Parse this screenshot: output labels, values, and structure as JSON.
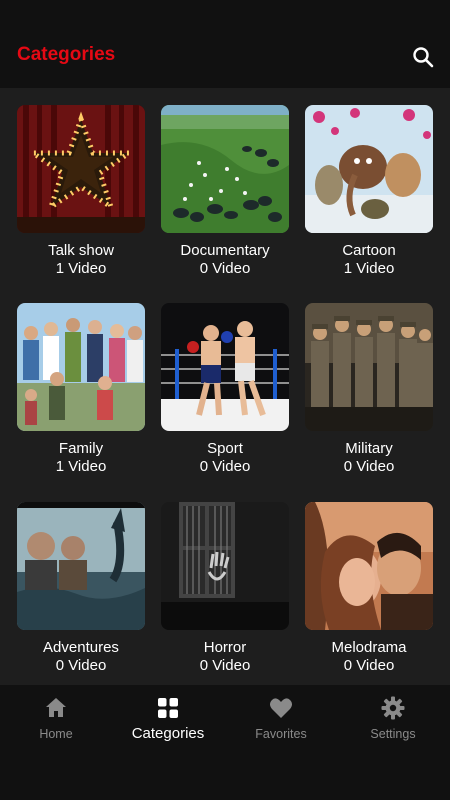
{
  "header": {
    "title": "Categories",
    "search_icon": "search-icon"
  },
  "categories": [
    {
      "name": "Talk show",
      "count": "1 Video"
    },
    {
      "name": "Documentary",
      "count": "0 Video"
    },
    {
      "name": "Cartoon",
      "count": "1 Video"
    },
    {
      "name": "Family",
      "count": "1 Video"
    },
    {
      "name": "Sport",
      "count": "0 Video"
    },
    {
      "name": "Military",
      "count": "0 Video"
    },
    {
      "name": "Adventures",
      "count": "0 Video"
    },
    {
      "name": "Horror",
      "count": "0 Video"
    },
    {
      "name": "Melodrama",
      "count": "0 Video"
    }
  ],
  "bottom_nav": {
    "items": [
      {
        "label": "Home",
        "icon": "home-icon"
      },
      {
        "label": "Categories",
        "icon": "grid-icon",
        "active": true
      },
      {
        "label": "Favorites",
        "icon": "heart-icon"
      },
      {
        "label": "Settings",
        "icon": "gear-icon"
      }
    ]
  },
  "colors": {
    "accent": "#e50914",
    "background": "#1e1e1e",
    "bar": "#111111",
    "inactive": "#8a8a8a"
  }
}
